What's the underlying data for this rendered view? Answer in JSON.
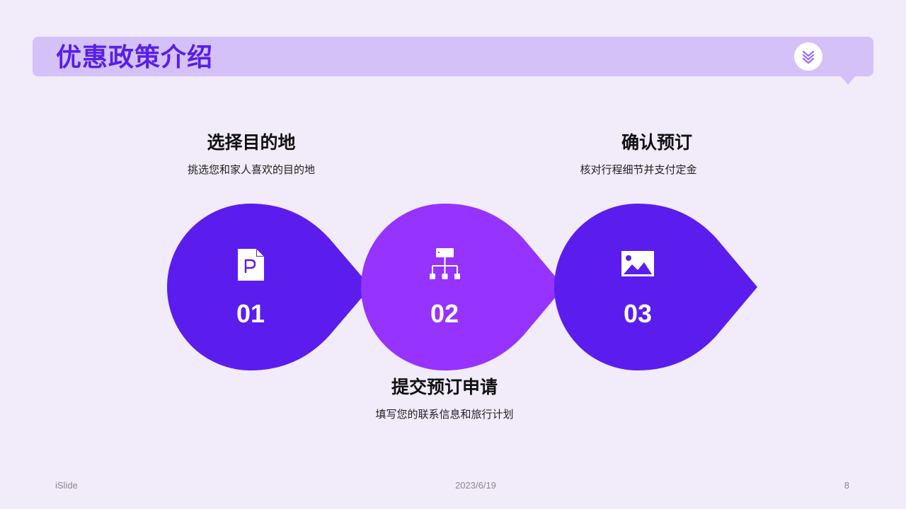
{
  "header": {
    "title": "优惠政策介绍",
    "icon": "double-chevron-down-icon"
  },
  "steps": [
    {
      "number": "01",
      "title": "选择目的地",
      "description": "挑选您和家人喜欢的目的地",
      "icon": "ppt-file-icon",
      "color": "#5b1ded"
    },
    {
      "number": "02",
      "title": "提交预订申请",
      "description": "填写您的联系信息和旅行计划",
      "icon": "hierarchy-icon",
      "color": "#9633ff"
    },
    {
      "number": "03",
      "title": "确认预订",
      "description": "核对行程细节并支付定金",
      "icon": "image-icon",
      "color": "#5b1ded"
    }
  ],
  "footer": {
    "brand": "iSlide",
    "date": "2023/6/19",
    "page": "8"
  },
  "colors": {
    "background": "#f1ebfa",
    "title_bar": "#d3c1f7",
    "title_text": "#5a1ee8",
    "accent_dark": "#5b1ded",
    "accent_light": "#9633ff"
  }
}
